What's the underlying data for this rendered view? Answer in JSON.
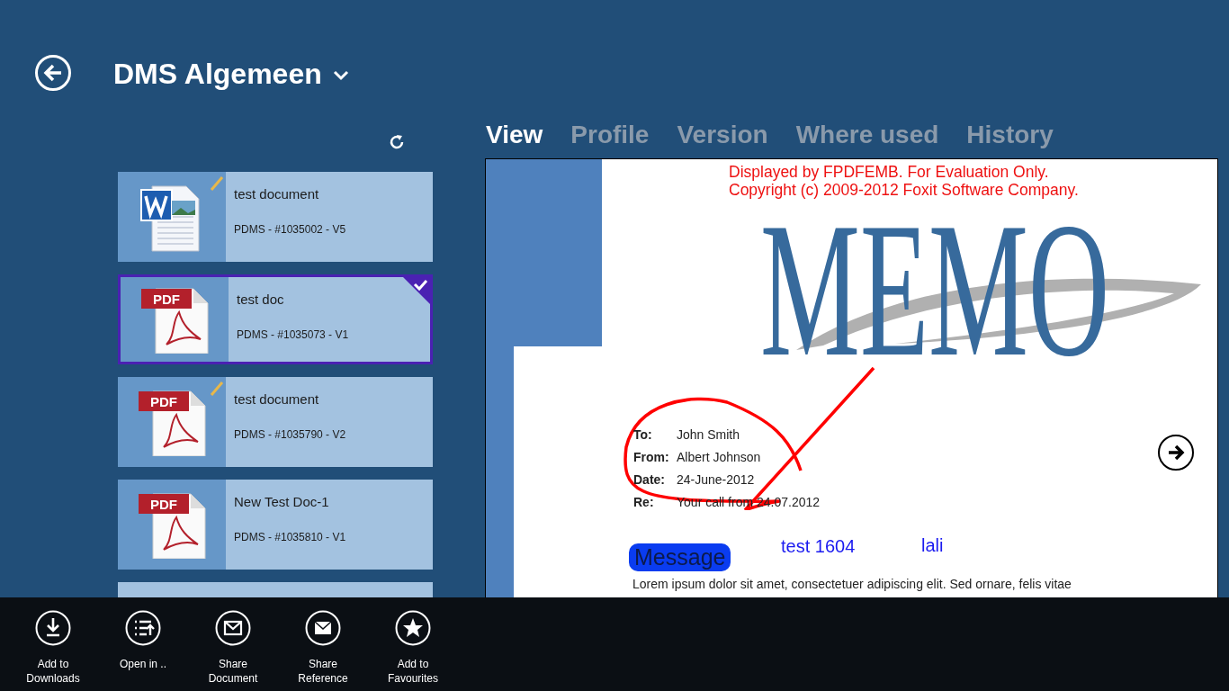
{
  "header": {
    "title": "DMS Algemeen"
  },
  "documents": [
    {
      "kind": "word",
      "title": "test document",
      "meta": "PDMS - #1035002 - V5",
      "pencil_mark": true,
      "selected": false
    },
    {
      "kind": "pdf",
      "badge": "PDF",
      "title": "test doc",
      "meta": "PDMS - #1035073 - V1",
      "pencil_mark": false,
      "selected": true
    },
    {
      "kind": "pdf",
      "badge": "PDF",
      "title": "test document",
      "meta": "PDMS - #1035790 - V2",
      "pencil_mark": true,
      "selected": false
    },
    {
      "kind": "pdf",
      "badge": "PDF",
      "title": "New Test Doc-1",
      "meta": "PDMS - #1035810 - V1",
      "pencil_mark": false,
      "selected": false
    }
  ],
  "tabs": [
    {
      "label": "View",
      "selected": true
    },
    {
      "label": "Profile",
      "selected": false
    },
    {
      "label": "Version",
      "selected": false
    },
    {
      "label": "Where used",
      "selected": false
    },
    {
      "label": "History",
      "selected": false
    }
  ],
  "preview": {
    "notice": [
      "Displayed by FPDFEMB. For Evaluation Only.",
      "Copyright (c) 2009-2012 Foxit Software Company."
    ],
    "heading": "MEMO",
    "fields": [
      {
        "label": "To:",
        "value": "John Smith"
      },
      {
        "label": "From:",
        "value": "Albert Johnson"
      },
      {
        "label": "Date:",
        "value": "24-June-2012"
      },
      {
        "label": "Re:",
        "value": "Your call from 24.07.2012"
      }
    ],
    "message": "Message",
    "note_1": "test 1604",
    "note_2": "lali",
    "body_lines": [
      {
        "text": "Lorem ipsum dolor sit amet, consectetuer adipiscing elit. Sed ornare, felis vitae",
        "highlighted": false
      }
    ]
  },
  "app_bar": [
    {
      "kind": "download",
      "label": "Add to Downloads"
    },
    {
      "kind": "open",
      "label": "Open in .."
    },
    {
      "kind": "share_doc",
      "label": "Share Document"
    },
    {
      "kind": "share_ref",
      "label": "Share Reference"
    },
    {
      "kind": "favourite",
      "label": "Add to Favourites"
    }
  ]
}
